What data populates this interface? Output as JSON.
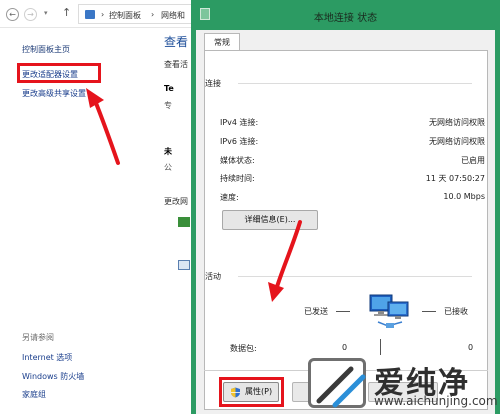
{
  "control_panel": {
    "breadcrumb": [
      "控制面板",
      "网络和"
    ],
    "sidebar": {
      "home": "控制面板主页",
      "adapter_settings": "更改适配器设置",
      "sharing_settings": "更改高级共享设置"
    },
    "see_also": {
      "heading": "另请参阅",
      "items": [
        "Internet 选项",
        "Windows 防火墙",
        "家庭组"
      ]
    },
    "main_fragments": {
      "title": "查看",
      "line1": "查看活",
      "line2": "Te",
      "line3": "专",
      "line4": "未",
      "line5": "公",
      "line6": "更改网"
    }
  },
  "dialog": {
    "title": "本地连接 状态",
    "tab": "常规",
    "connection": {
      "label": "连接",
      "rows": [
        {
          "key": "IPv4 连接:",
          "value": "无网络访问权限"
        },
        {
          "key": "IPv6 连接:",
          "value": "无网络访问权限"
        },
        {
          "key": "媒体状态:",
          "value": "已启用"
        },
        {
          "key": "持续时间:",
          "value": "11 天 07:50:27"
        },
        {
          "key": "速度:",
          "value": "10.0 Mbps"
        }
      ],
      "details_button": "详细信息(E)..."
    },
    "activity": {
      "label": "活动",
      "sent_label": "已发送",
      "received_label": "已接收",
      "dash": "—",
      "packets_label": "数据包:",
      "packets_sent": "0",
      "packets_received": "0"
    },
    "properties_button": "属性(P)"
  },
  "watermark": {
    "brand": "爱纯净",
    "url": "www.aichunjing.com"
  },
  "colors": {
    "dialog_accent": "#2c9b63",
    "highlight_red": "#e5141c",
    "link_blue": "#1a3e8c"
  }
}
